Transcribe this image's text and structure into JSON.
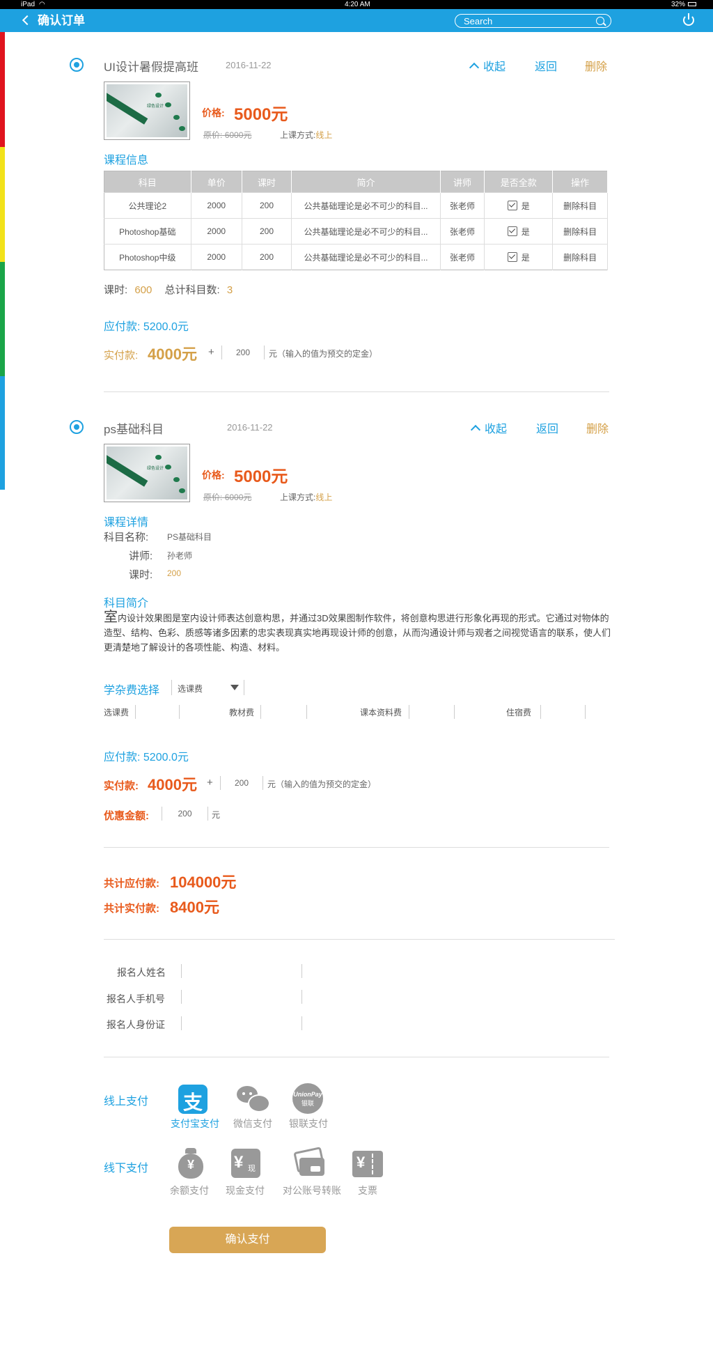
{
  "status": {
    "device": "iPad",
    "time": "4:20 AM",
    "battery": "32%"
  },
  "nav": {
    "title": "确认订单",
    "search_placeholder": "Search"
  },
  "order1": {
    "course_name": "UI设计暑假提高班",
    "date": "2016-11-22",
    "collapse": "收起",
    "back": "返回",
    "delete": "删除",
    "price_label": "价格:",
    "price": "5000元",
    "original_label": "原价:",
    "original": "6000元",
    "mode_label": "上课方式:",
    "mode": "线上",
    "info_title": "课程信息",
    "columns": [
      "科目",
      "单价",
      "课时",
      "简介",
      "讲师",
      "是否全款",
      "操作"
    ],
    "rows": [
      {
        "subject": "公共理论2",
        "price": "2000",
        "hours": "200",
        "intro": "公共基础理论是必不可少的科目...",
        "teacher": "张老师",
        "full": "是",
        "action": "删除科目"
      },
      {
        "subject": "Photoshop基础",
        "price": "2000",
        "hours": "200",
        "intro": "公共基础理论是必不可少的科目...",
        "teacher": "张老师",
        "full": "是",
        "action": "删除科目"
      },
      {
        "subject": "Photoshop中级",
        "price": "2000",
        "hours": "200",
        "intro": "公共基础理论是必不可少的科目...",
        "teacher": "张老师",
        "full": "是",
        "action": "删除科目"
      }
    ],
    "hours_label": "课时:",
    "hours": "600",
    "count_label": "总计科目数:",
    "count": "3",
    "payable_label": "应付款:",
    "payable": "5200.0元",
    "paid_label": "实付款:",
    "paid": "4000元",
    "plus": "+",
    "deposit": "200",
    "deposit_hint": "元（输入的值为预交的定金）"
  },
  "order2": {
    "course_name": "ps基础科目",
    "date": "2016-11-22",
    "collapse": "收起",
    "back": "返回",
    "delete": "删除",
    "price_label": "价格:",
    "price": "5000元",
    "original_label": "原价:",
    "original": "6000元",
    "mode_label": "上课方式:",
    "mode": "线上",
    "detail_title": "课程详情",
    "name_label": "科目名称:",
    "name": "PS基础科目",
    "teacher_label": "讲师:",
    "teacher": "孙老师",
    "hours_label": "课时:",
    "hours": "200",
    "intro_title": "科目简介",
    "intro_first": "室",
    "intro_rest": "内设计效果图是室内设计师表达创意构思，并通过3D效果图制作软件，将创意构思进行形象化再现的形式。它通过对物体的造型、结构、色彩、质感等诸多因素的忠实表现真实地再现设计师的创意，从而沟通设计师与观者之间视觉语言的联系，使人们更清楚地了解设计的各项性能、构造、材料。",
    "fee_title": "学杂费选择",
    "fee_select": "选课费",
    "fees": [
      "选课费",
      "教材费",
      "课本资料费",
      "住宿费"
    ],
    "payable_label": "应付款:",
    "payable": "5200.0元",
    "paid_label": "实付款:",
    "paid": "4000元",
    "plus": "+",
    "deposit": "200",
    "deposit_hint": "元（输入的值为预交的定金）",
    "discount_label": "优惠金额:",
    "discount": "200",
    "discount_unit": "元"
  },
  "totals": {
    "payable_label": "共计应付款:",
    "payable": "104000元",
    "paid_label": "共计实付款:",
    "paid": "8400元"
  },
  "form": {
    "name_label": "报名人姓名",
    "phone_label": "报名人手机号",
    "id_label": "报名人身份证"
  },
  "payment": {
    "online_label": "线上支付",
    "online": [
      {
        "label": "支付宝支付",
        "icon": "alipay-icon"
      },
      {
        "label": "微信支付",
        "icon": "wechat-icon"
      },
      {
        "label": "银联支付",
        "icon": "unionpay-icon"
      }
    ],
    "unionpay_text": "UnionPay",
    "unionpay_sub": "银联",
    "offline_label": "线下支付",
    "offline": [
      {
        "label": "余额支付",
        "icon": "money-bag-icon"
      },
      {
        "label": "现金支付",
        "icon": "cash-icon"
      },
      {
        "label": "对公账号转账",
        "icon": "bank-card-icon"
      },
      {
        "label": "支票",
        "icon": "cheque-icon"
      }
    ],
    "cash_text": "现",
    "confirm": "确认支付"
  },
  "colors": {
    "accent": "#1ea1e0",
    "gold": "#d4a048",
    "orange": "#e85a1c",
    "sidebar": [
      "#e0141e",
      "#f2e21a",
      "#1aa548",
      "#1ea1e0"
    ]
  }
}
